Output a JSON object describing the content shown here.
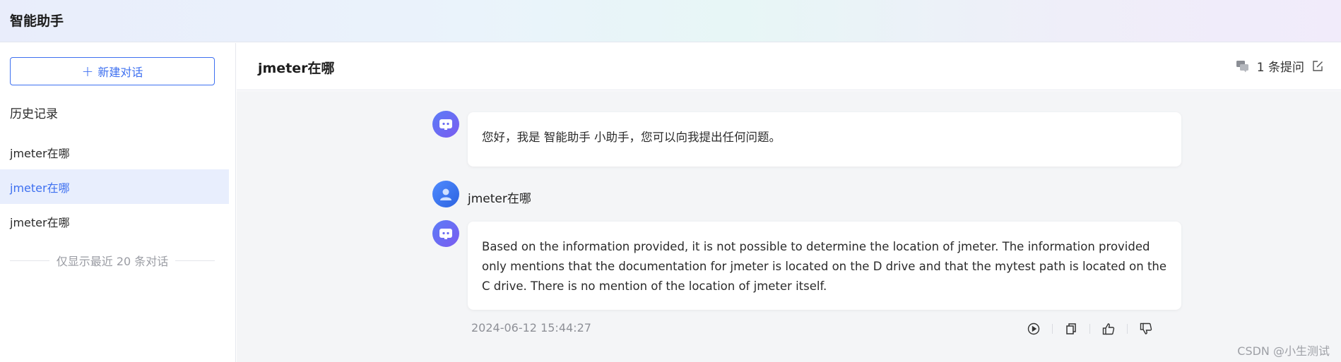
{
  "app": {
    "title": "智能助手"
  },
  "sidebar": {
    "new_chat_label": "新建对话",
    "history_title": "历史记录",
    "items": [
      {
        "label": "jmeter在哪"
      },
      {
        "label": "jmeter在哪",
        "active": true
      },
      {
        "label": "jmeter在哪"
      }
    ],
    "note": "仅显示最近 20 条对话"
  },
  "header": {
    "title": "jmeter在哪",
    "question_count": "1 条提问"
  },
  "chat": {
    "greeting": "您好，我是 智能助手 小助手，您可以向我提出任何问题。",
    "user_message": "jmeter在哪",
    "answer": "Based on the information provided, it is not possible to determine the location of jmeter. The information provided only mentions that the documentation for jmeter is located on the D drive and that the mytest path is located on the C drive. There is no mention of the location of jmeter itself.",
    "timestamp": "2024-06-12 15:44:27"
  },
  "watermark": "CSDN @小生测试",
  "colors": {
    "accent": "#3e70f0",
    "active_bg": "#e8eefd"
  }
}
